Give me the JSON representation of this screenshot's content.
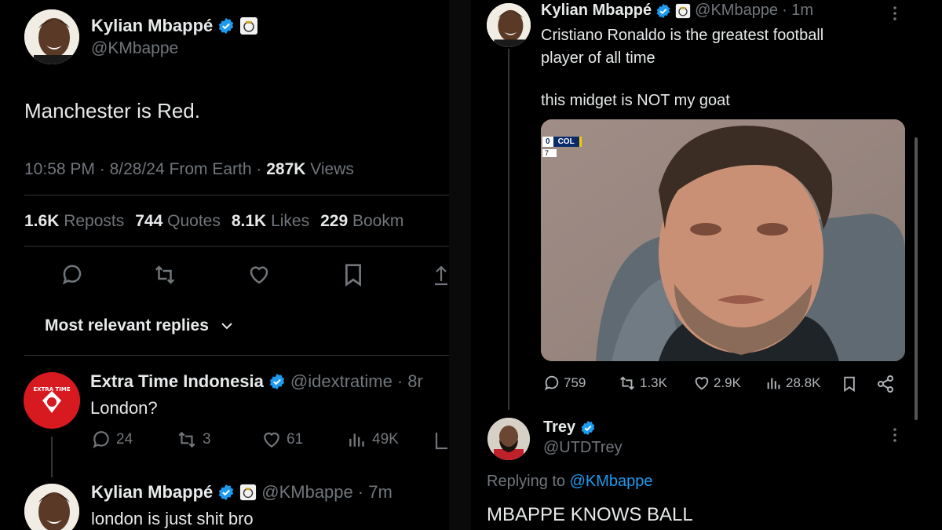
{
  "left": {
    "author": {
      "name": "Kylian Mbappé",
      "handle": "@KMbappe"
    },
    "tweet_text": "Manchester is Red.",
    "meta": {
      "time": "10:58 PM",
      "date": "8/28/24",
      "source": "From Earth",
      "views_count": "287K",
      "views_label": "Views",
      "dot": "·"
    },
    "stats": [
      {
        "count": "1.6K",
        "label": "Reposts"
      },
      {
        "count": "744",
        "label": "Quotes"
      },
      {
        "count": "8.1K",
        "label": "Likes"
      },
      {
        "count": "229",
        "label": "Bookm"
      }
    ],
    "sort_label": "Most relevant replies",
    "reply1": {
      "name": "Extra Time Indonesia",
      "handle": "@idextratime",
      "age": "· 8r",
      "text": "London?",
      "actions": {
        "replies": "24",
        "reposts": "3",
        "likes": "61",
        "views": "49K"
      },
      "logo_text": "EXTRA TIME"
    },
    "reply2": {
      "name": "Kylian Mbappé",
      "handle": "@KMbappe",
      "age": "· 7m",
      "text": "london is just shit bro"
    }
  },
  "right": {
    "tweet": {
      "name": "Kylian Mbappé",
      "handle": "@KMbappe",
      "age": "· 1m",
      "text_line1": "Cristiano Ronaldo is the greatest football",
      "text_line2": "player of all time",
      "text_line3": "this midget is NOT my goat",
      "scorebug": {
        "score": "0",
        "team": "COL",
        "sub": "7"
      },
      "actions": {
        "replies": "759",
        "reposts": "1.3K",
        "likes": "2.9K",
        "views": "28.8K"
      }
    },
    "reply": {
      "name": "Trey",
      "handle": "@UTDTrey",
      "replying_prefix": "Replying to",
      "replying_handle": "@KMbappe",
      "text": "MBAPPE KNOWS BALL"
    }
  },
  "colors": {
    "verified": "#1d9bf0",
    "muted": "#71767b",
    "text": "#e7e9ea",
    "link": "#1d9bf0",
    "extra_time_red": "#d71920"
  }
}
